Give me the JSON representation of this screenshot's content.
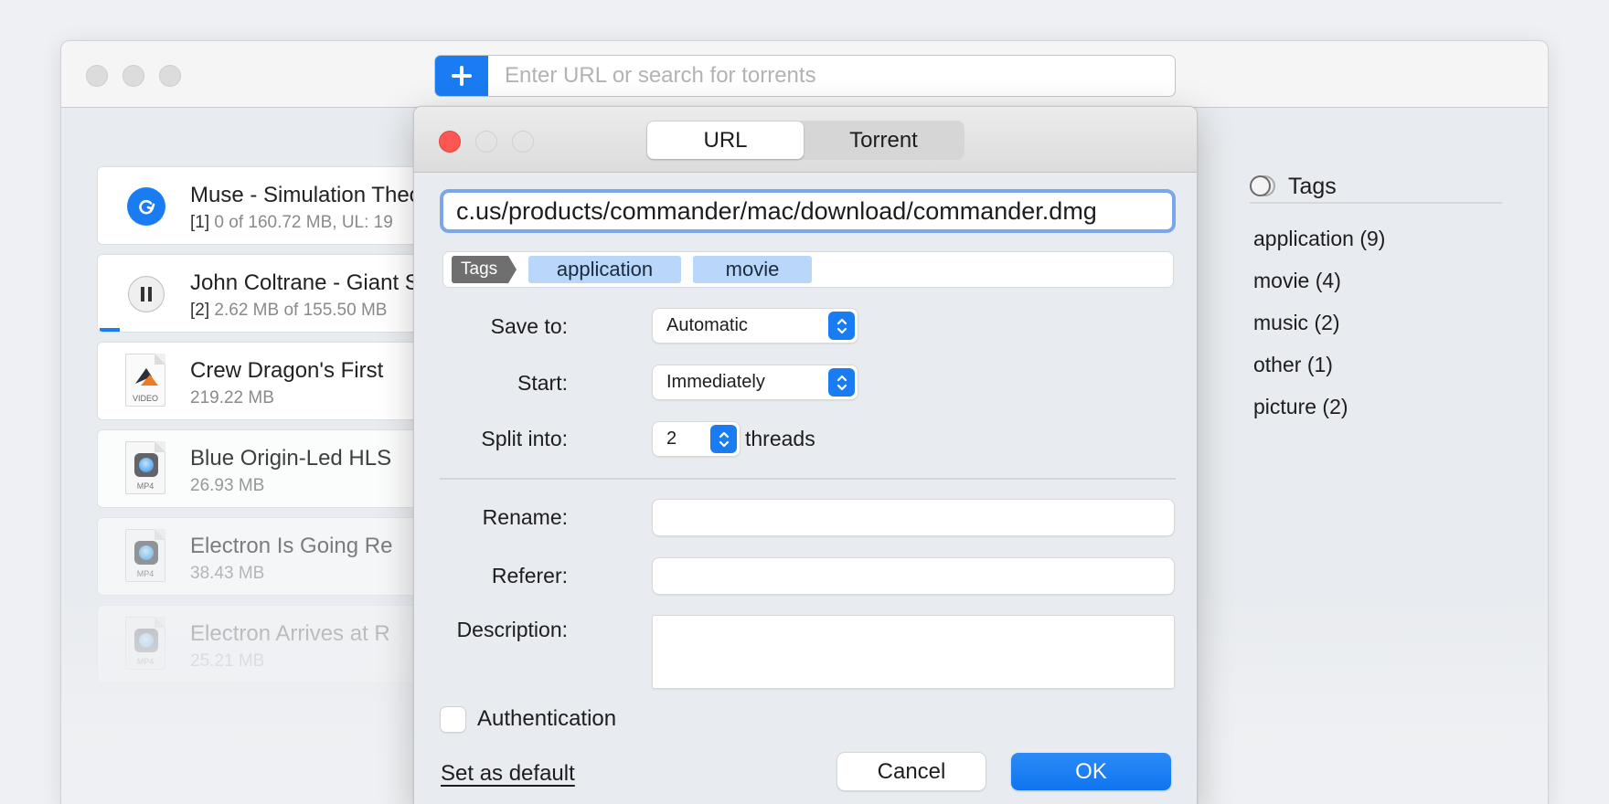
{
  "main_window": {
    "search": {
      "placeholder": "Enter URL or search for torrents",
      "value": "",
      "add_icon": "plus-icon"
    },
    "downloads": [
      {
        "title": "Muse - Simulation Theory",
        "index": "[1]",
        "detail": "0 of 160.72 MB, UL: 19",
        "icon": "refresh-icon",
        "status": "active"
      },
      {
        "title": "John Coltrane - Giant Steps",
        "index": "[2]",
        "detail": "2.62 MB of 155.50 MB",
        "icon": "pause-icon",
        "status": "paused",
        "progress": 0.017
      },
      {
        "title": "Crew Dragon's First",
        "index": "",
        "detail": "219.22 MB",
        "icon": "video-file-icon",
        "file_label": "VIDEO"
      },
      {
        "title": "Blue Origin-Led HLS",
        "index": "",
        "detail": "26.93 MB",
        "icon": "mp4-file-icon",
        "file_label": "MP4"
      },
      {
        "title": "Electron Is Going Re",
        "index": "",
        "detail": "38.43 MB",
        "icon": "mp4-file-icon",
        "file_label": "MP4"
      },
      {
        "title": "Electron Arrives at R",
        "index": "",
        "detail": "25.21 MB",
        "icon": "mp4-file-icon",
        "file_label": "MP4"
      }
    ],
    "tags_panel": {
      "title": "Tags",
      "items": [
        {
          "label": "application (9)"
        },
        {
          "label": "movie (4)"
        },
        {
          "label": "music (2)"
        },
        {
          "label": "other (1)"
        },
        {
          "label": "picture (2)"
        }
      ]
    }
  },
  "dialog": {
    "tabs": [
      {
        "label": "URL",
        "active": true
      },
      {
        "label": "Torrent",
        "active": false
      }
    ],
    "url_value": "c.us/products/commander/mac/download/commander.dmg",
    "tags": {
      "badge": "Tags",
      "chips": [
        "application",
        "movie"
      ]
    },
    "save_to": {
      "label": "Save to:",
      "value": "Automatic"
    },
    "start": {
      "label": "Start:",
      "value": "Immediately"
    },
    "split": {
      "label": "Split into:",
      "value": "2",
      "suffix": "threads"
    },
    "rename": {
      "label": "Rename:",
      "value": ""
    },
    "referer": {
      "label": "Referer:",
      "value": ""
    },
    "description": {
      "label": "Description:",
      "value": ""
    },
    "authentication": {
      "label": "Authentication",
      "checked": false
    },
    "set_default": "Set as default",
    "cancel": "Cancel",
    "ok": "OK",
    "colors": {
      "accent": "#1a7cf2",
      "close": "#fc5753",
      "tag_chip": "#b9d7fb"
    }
  }
}
